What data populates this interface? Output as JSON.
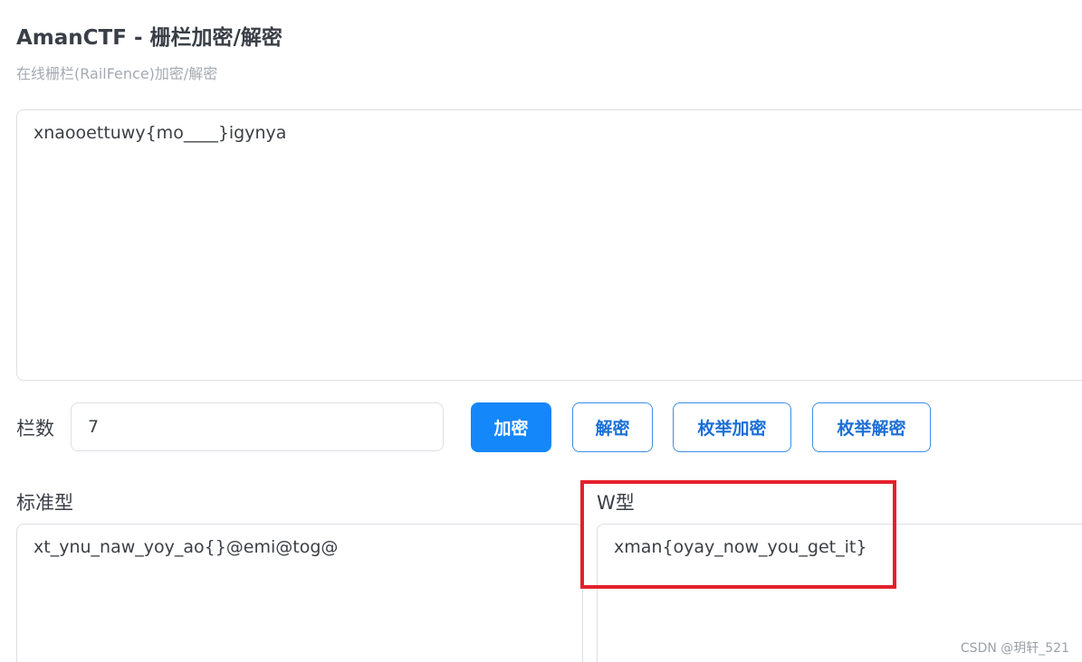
{
  "header": {
    "title": "AmanCTF - 栅栏加密/解密",
    "subtitle": "在线栅栏(RailFence)加密/解密"
  },
  "input": {
    "text": "xnaooettuwy{mo____}igynya"
  },
  "controls": {
    "rails_label": "栏数",
    "rails_value": "7",
    "encrypt_label": "加密",
    "decrypt_label": "解密",
    "enum_encrypt_label": "枚举加密",
    "enum_decrypt_label": "枚举解密"
  },
  "outputs": {
    "standard_label": "标准型",
    "standard_value": "xt_ynu_naw_yoy_ao{}@emi@tog@",
    "w_label": "W型",
    "w_value": "xman{oyay_now_you_get_it}"
  },
  "watermark": "CSDN @玥轩_521",
  "colors": {
    "primary": "#1487fb",
    "highlight": "#e3202b"
  }
}
